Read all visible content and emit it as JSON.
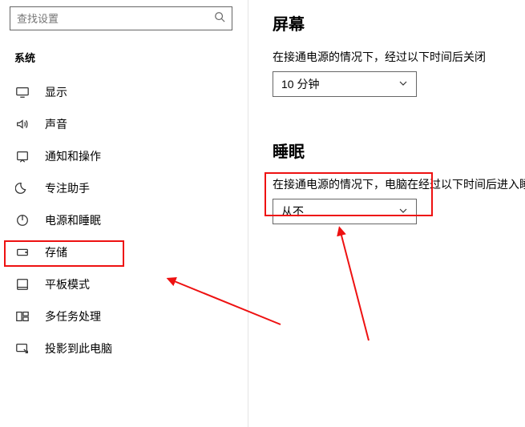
{
  "search": {
    "placeholder": "查找设置"
  },
  "sidebar": {
    "section": "系统",
    "items": [
      {
        "label": "显示"
      },
      {
        "label": "声音"
      },
      {
        "label": "通知和操作"
      },
      {
        "label": "专注助手"
      },
      {
        "label": "电源和睡眠"
      },
      {
        "label": "存储"
      },
      {
        "label": "平板模式"
      },
      {
        "label": "多任务处理"
      },
      {
        "label": "投影到此电脑"
      }
    ]
  },
  "main": {
    "screen": {
      "heading": "屏幕",
      "desc": "在接通电源的情况下，经过以下时间后关闭",
      "value": "10 分钟"
    },
    "sleep": {
      "heading": "睡眠",
      "desc": "在接通电源的情况下，电脑在经过以下时间后进入睡",
      "value": "从不"
    }
  }
}
